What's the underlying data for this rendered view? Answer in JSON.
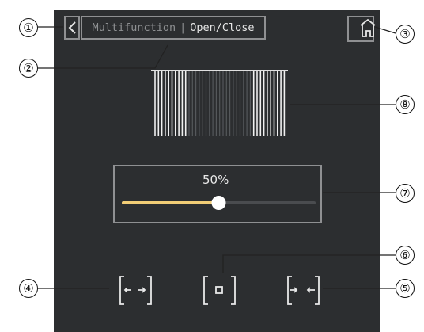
{
  "header": {
    "back_label": "<",
    "breadcrumb_parent": "Multifunction",
    "breadcrumb_separator": "|",
    "breadcrumb_current": "Open/Close",
    "home_icon": "home-icon"
  },
  "curtain": {
    "icon": "curtain-icon",
    "open_fraction": 0.5
  },
  "slider": {
    "value_label": "50%",
    "value": 0.5,
    "fill_color": "#f2cd76",
    "track_color": "#4a4c4f",
    "knob_color": "#ffffff"
  },
  "controls": {
    "open_icon": "curtain-open-icon",
    "stop_icon": "curtain-stop-icon",
    "close_icon": "curtain-close-icon"
  },
  "callouts": [
    "①",
    "②",
    "③",
    "④",
    "⑤",
    "⑥",
    "⑦",
    "⑧"
  ],
  "colors": {
    "screen_bg": "#2c2e30",
    "outline": "#8f9092",
    "text_active": "#e6e6e6",
    "text_muted": "#8e9092"
  }
}
